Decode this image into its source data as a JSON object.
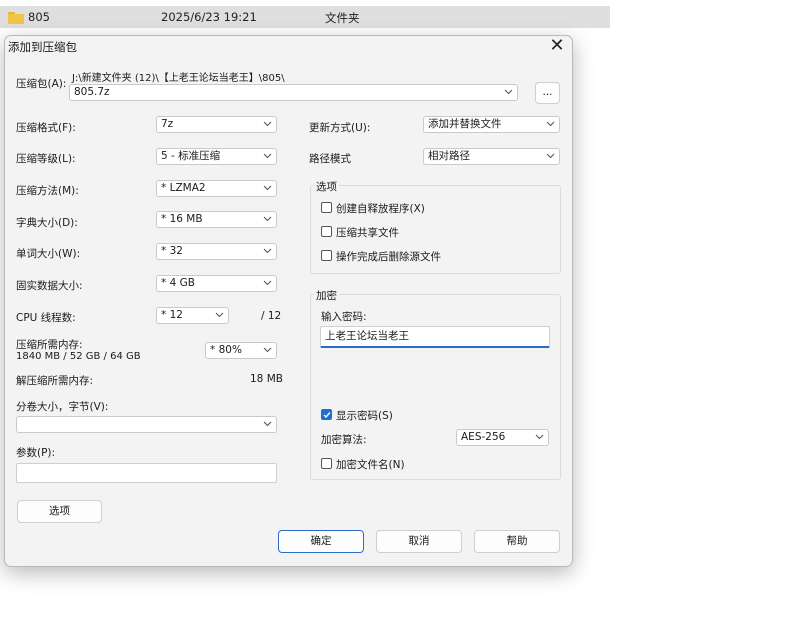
{
  "file_row": {
    "name": "805",
    "date": "2025/6/23 19:21",
    "type": "文件夹"
  },
  "dialog": {
    "title": "添加到压缩包",
    "close_glyph": "✕",
    "archive_label": "压缩包(A):",
    "archive_path": "J:\\新建文件夹 (12)\\【上老王论坛当老王】\\805\\",
    "archive_name": "805.7z",
    "browse_label": "...",
    "left": {
      "format_label": "压缩格式(F):",
      "format_value": "7z",
      "level_label": "压缩等级(L):",
      "level_value": "5 - 标准压缩",
      "method_label": "压缩方法(M):",
      "method_value": "*  LZMA2",
      "dict_label": "字典大小(D):",
      "dict_value": "*  16 MB",
      "word_label": "单词大小(W):",
      "word_value": "*  32",
      "solid_label": "固实数据大小:",
      "solid_value": "*  4 GB",
      "cpu_label": "CPU 线程数:",
      "cpu_value": "*  12",
      "cpu_total": "/ 12",
      "mem_label": "压缩所需内存:",
      "mem_detail": "1840 MB / 52 GB / 64 GB",
      "mem_value": "*  80%",
      "decomp_label": "解压缩所需内存:",
      "decomp_value": "18 MB",
      "volume_label": "分卷大小，字节(V):",
      "volume_value": "",
      "params_label": "参数(P):",
      "params_value": "",
      "options_button": "选项"
    },
    "right": {
      "update_label": "更新方式(U):",
      "update_value": "添加并替换文件",
      "pathmode_label": "路径模式",
      "pathmode_value": "相对路径",
      "options_group": "选项",
      "opt_sfx": "创建自释放程序(X)",
      "opt_shared": "压缩共享文件",
      "opt_delete": "操作完成后删除源文件",
      "encrypt_group": "加密",
      "password_label": "输入密码:",
      "password_value": "上老王论坛当老王",
      "show_password": "显示密码(S)",
      "enc_method_label": "加密算法:",
      "enc_method_value": "AES-256",
      "encrypt_names": "加密文件名(N)"
    },
    "buttons": {
      "ok": "确定",
      "cancel": "取消",
      "help": "帮助"
    }
  },
  "colors": {
    "accent": "#1f6fd0",
    "dialog_bg": "#f3f3f3"
  }
}
